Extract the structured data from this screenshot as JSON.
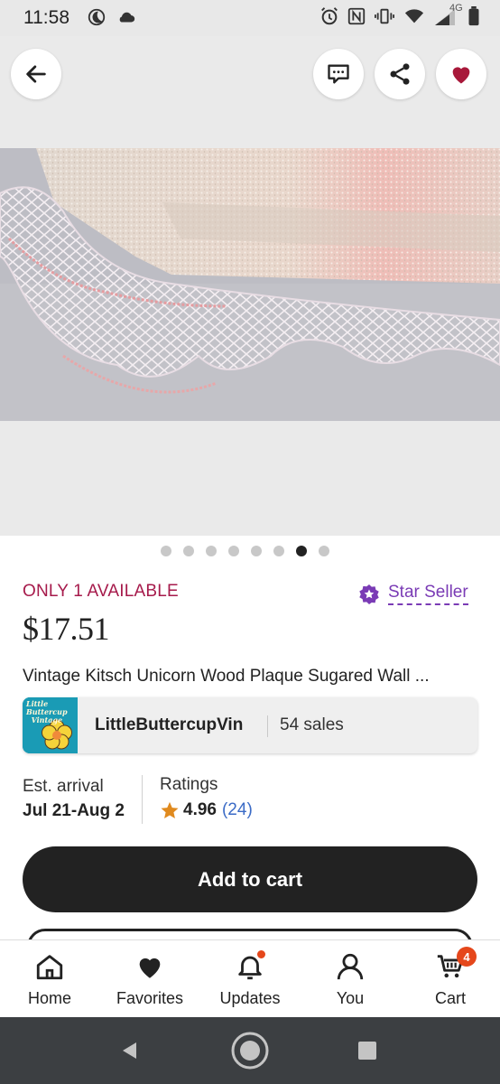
{
  "status_bar": {
    "time": "11:58",
    "network_label": "4G",
    "icons": [
      "moon-icon",
      "cloud-icon",
      "alarm-icon",
      "nfc-icon",
      "vibrate-icon",
      "wifi-icon",
      "signal-icon",
      "battery-icon"
    ]
  },
  "gallery": {
    "image_count": 8,
    "active_index": 6,
    "photo_subject": "pink sugared wood plaque with lace ruffle edge",
    "buttons": {
      "back": "back-arrow-icon",
      "messages": "message-icon",
      "share": "share-icon",
      "favorite": "heart-icon"
    }
  },
  "listing": {
    "availability": "ONLY 1 AVAILABLE",
    "star_seller": "Star Seller",
    "price": "$17.51",
    "title": "Vintage Kitsch Unicorn Wood Plaque Sugared Wall ..."
  },
  "shop": {
    "name": "LittleButtercupVin",
    "sales": "54 sales",
    "logo_text": "Little Buttercup Vintage"
  },
  "info": {
    "est_label": "Est. arrival",
    "est_value": "Jul 21-Aug 2",
    "ratings_label": "Ratings",
    "rating_value": "4.96",
    "rating_count": "(24)"
  },
  "actions": {
    "add_to_cart": "Add to cart"
  },
  "bottom_nav": {
    "items": [
      {
        "label": "Home",
        "icon": "home-icon"
      },
      {
        "label": "Favorites",
        "icon": "heart-icon"
      },
      {
        "label": "Updates",
        "icon": "bell-icon"
      },
      {
        "label": "You",
        "icon": "person-icon"
      },
      {
        "label": "Cart",
        "icon": "cart-icon"
      }
    ],
    "cart_count": "4"
  },
  "colors": {
    "accent_dark": "#222222",
    "availability": "#a61a4b",
    "star_seller": "#7a3bb5",
    "favorite_heart": "#a8183a",
    "badge": "#e5471b",
    "rating_link": "#3b6bc6",
    "star": "#e08a1e"
  }
}
